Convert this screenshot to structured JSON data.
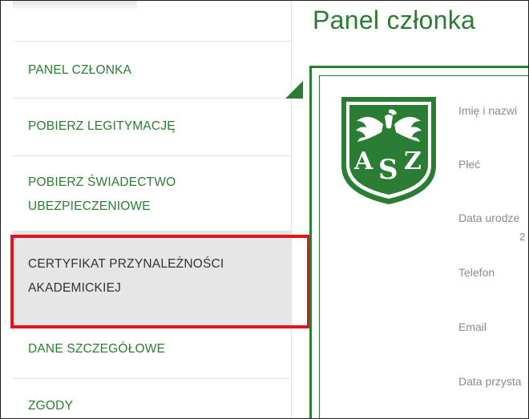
{
  "page": {
    "title": "Panel członka"
  },
  "sidebar": {
    "items": [
      {
        "lines": [
          "PANEL CZŁONKA"
        ],
        "active": true
      },
      {
        "lines": [
          "POBIERZ LEGITYMACJĘ"
        ]
      },
      {
        "lines": [
          "POBIERZ ŚWIADECTWO",
          "UBEZPIECZENIOWE"
        ]
      },
      {
        "lines": [
          "CERTYFIKAT PRZYNALEŻNOŚCI",
          "AKADEMICKIEJ"
        ],
        "highlighted": true
      },
      {
        "lines": [
          "DANE SZCZEGÓŁOWE"
        ]
      },
      {
        "lines": [
          "ZGODY"
        ]
      }
    ]
  },
  "card": {
    "logo": {
      "text": "AZS",
      "icon": "azs-eagle-logo"
    },
    "fields": [
      {
        "label": "Imię i nazwi"
      },
      {
        "label": "Płeć"
      },
      {
        "label": "Data urodze"
      },
      {
        "label": "Telefon"
      },
      {
        "label": "Email"
      },
      {
        "label": "Data przysta"
      }
    ],
    "fragment": "2"
  },
  "colors": {
    "brand_green": "#2a7d32",
    "highlight_red": "#e5141a",
    "active_bg": "#e6e6e6"
  }
}
